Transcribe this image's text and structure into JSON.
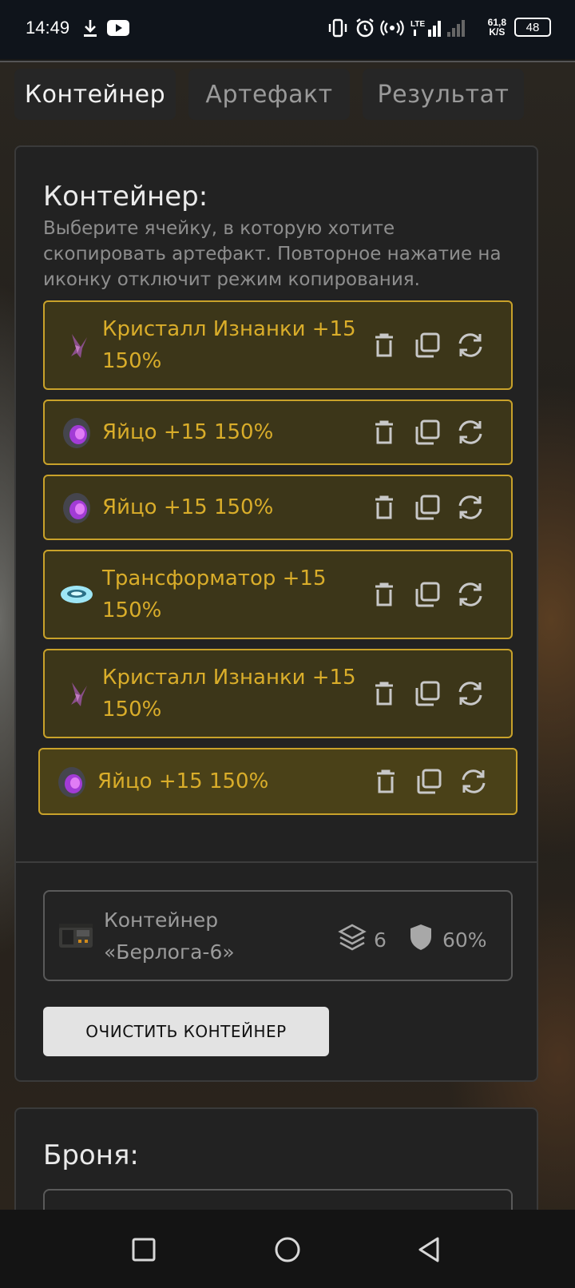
{
  "status_bar": {
    "time": "14:49",
    "net_speed_value": "61,8",
    "net_speed_unit": "K/S",
    "battery": "48",
    "network_label": "LTE"
  },
  "tabs": [
    {
      "label": "Контейнер",
      "active": true
    },
    {
      "label": "Артефакт",
      "active": false
    },
    {
      "label": "Результат",
      "active": false
    }
  ],
  "container_section": {
    "title": "Контейнер:",
    "description": "Выберите ячейку, в которую хотите скопировать артефакт. Повторное нажатие на иконку отключит режим копирования.",
    "items": [
      {
        "name": "Кристалл Изнанки +15 150%",
        "icon": "crystal-icon"
      },
      {
        "name": "Яйцо +15 150%",
        "icon": "egg-icon"
      },
      {
        "name": "Яйцо +15 150%",
        "icon": "egg-icon"
      },
      {
        "name": "Трансформатор +15 150%",
        "icon": "transformer-icon"
      },
      {
        "name": "Кристалл Изнанки +15 150%",
        "icon": "crystal-icon"
      },
      {
        "name": "Яйцо +15 150%",
        "icon": "egg-icon"
      }
    ],
    "actions": [
      "trash-icon",
      "copy-icon",
      "refresh-icon"
    ],
    "container": {
      "name": "Контейнер «Берлога-6»",
      "slots": "6",
      "protection": "60%"
    },
    "clear_button": "ОЧИСТИТЬ КОНТЕЙНЕР"
  },
  "armor_section": {
    "title": "Броня:"
  },
  "colors": {
    "accent": "#c9a22a",
    "item_text": "#d9ad2a",
    "item_bg": "#3c3619",
    "panel_bg": "#222222"
  }
}
